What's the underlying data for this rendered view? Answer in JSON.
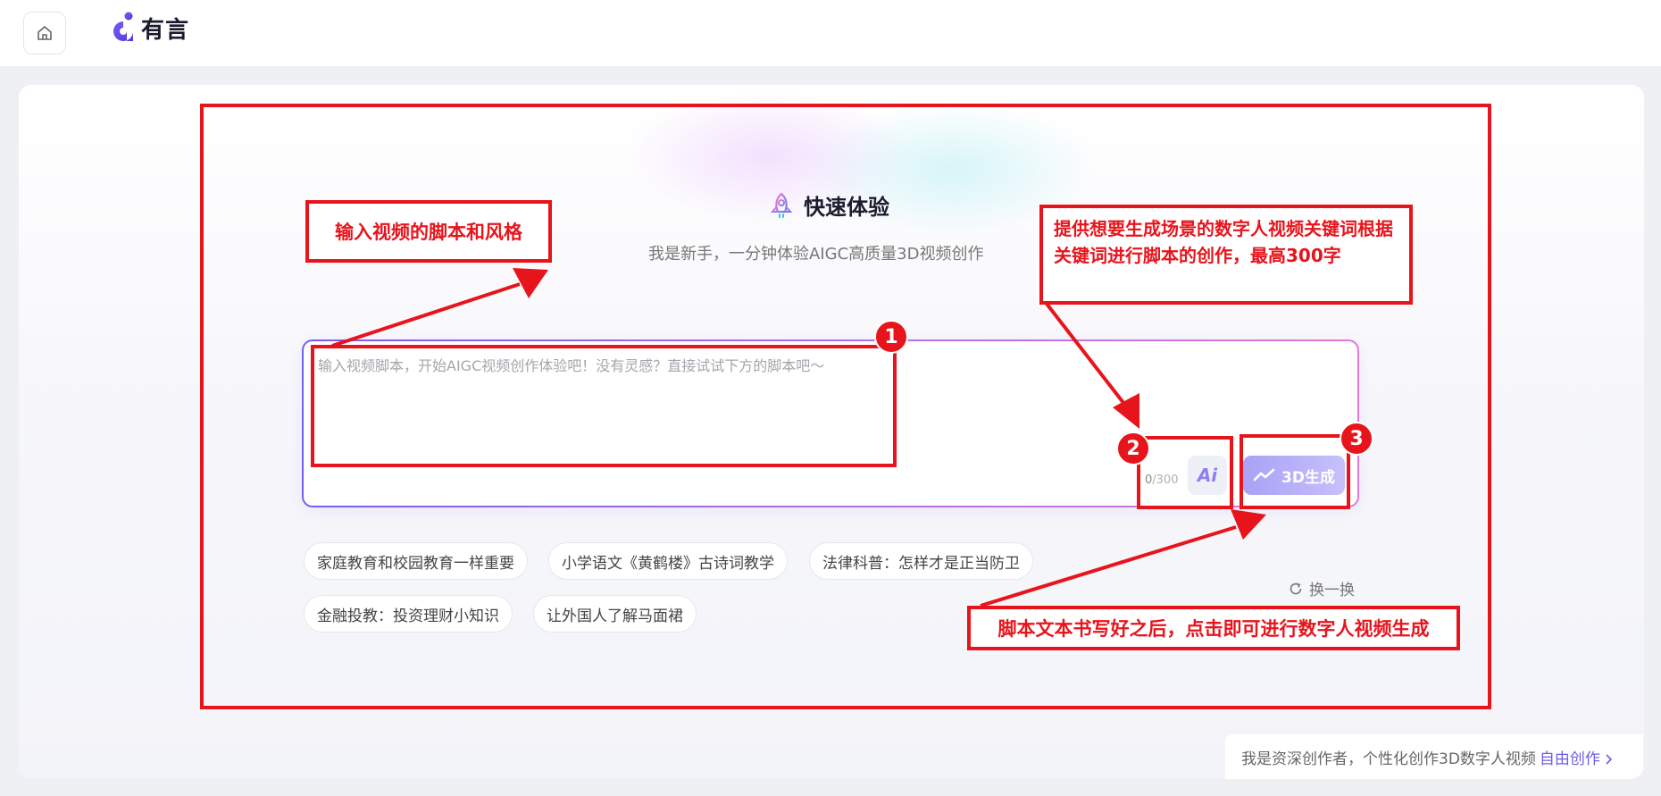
{
  "header": {
    "home_icon": "home-icon",
    "logo_text": "有言"
  },
  "hero": {
    "icon": "rocket-icon",
    "title": "快速体验",
    "subtitle": "我是新手，一分钟体验AIGC高质量3D视频创作"
  },
  "script_input": {
    "placeholder": "输入视频脚本，开始AIGC视频创作体验吧！没有灵感？直接试试下方的脚本吧～",
    "value": "",
    "count_current": "0",
    "count_max": "/300"
  },
  "buttons": {
    "ai_label": "Ai",
    "generate_label": "3D生成",
    "refresh_label": "换一换"
  },
  "suggestions": [
    "家庭教育和校园教育一样重要",
    "小学语文《黄鹤楼》古诗词教学",
    "法律科普：怎样才是正当防卫",
    "金融投教：投资理财小知识",
    "让外国人了解马面裙"
  ],
  "footer": {
    "text": "我是资深创作者，个性化创作3D数字人视频",
    "link": "自由创作"
  },
  "annotations": {
    "label_1": "输入视频的脚本和风格",
    "label_2": "提供想要生成场景的数字人视频关键词根据关键词进行脚本的创作，最高300字",
    "label_3": "脚本文本书写好之后，点击即可进行数字人视频生成",
    "badge_1": "1",
    "badge_2": "2",
    "badge_3": "3",
    "color": "#e8141c"
  },
  "colors": {
    "accent": "#6c5ce7",
    "generate_button": "#b3acf8"
  }
}
